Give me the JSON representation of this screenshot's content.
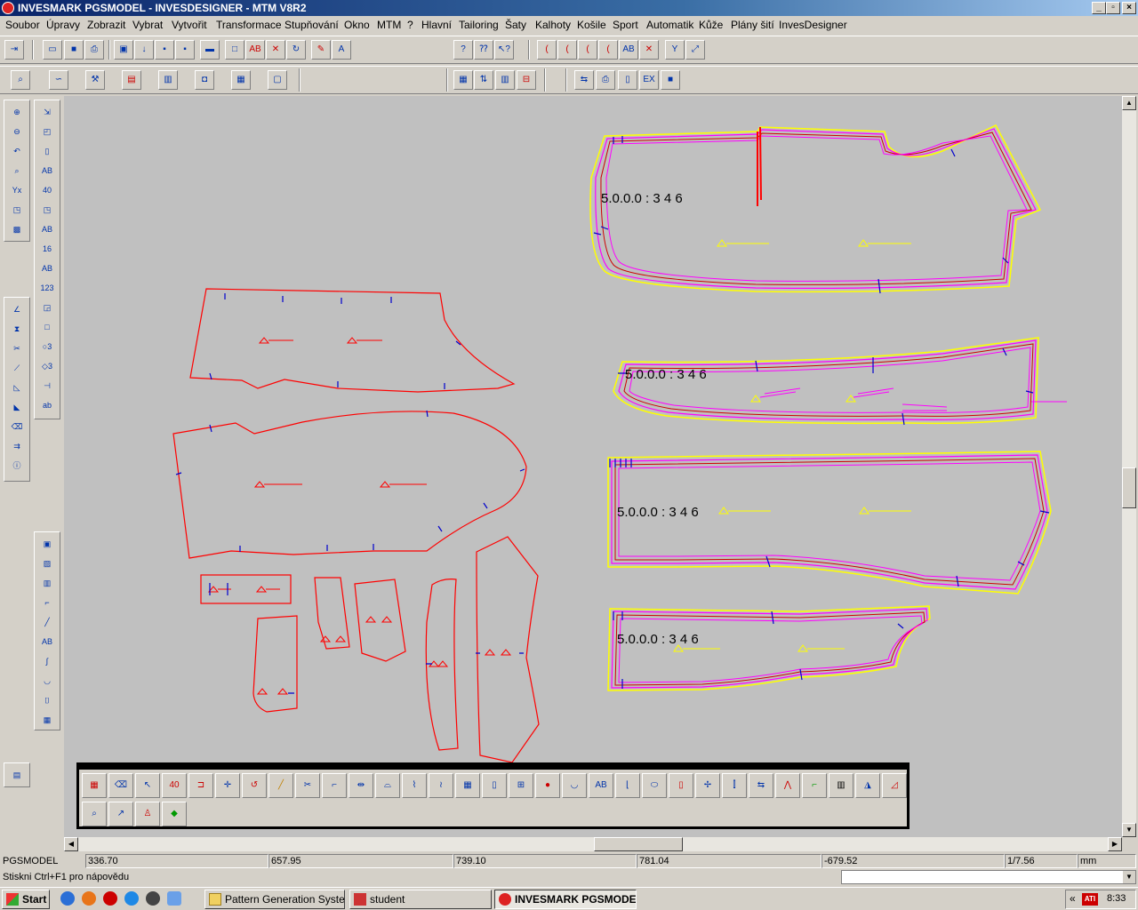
{
  "window": {
    "title": "INVESMARK PGSMODEL - INVESDESIGNER - MTM V8R2",
    "minimize": "_",
    "restore": "▫",
    "close": "×"
  },
  "menu": [
    "Soubor",
    "Úpravy",
    "Zobrazit",
    "Vybrat",
    "Vytvořit",
    "Transformace",
    "Stupňování",
    "Okno",
    "MTM",
    "?",
    "Hlavní",
    "Tailoring",
    "Šaty",
    "Kalhoty",
    "Košile",
    "Sport",
    "Automatik",
    "Kůže",
    "Plány šití",
    "InvesDesigner"
  ],
  "toolbar": {
    "color_swatch": "#e00000",
    "line_style": "———"
  },
  "canvas": {
    "piece_labels": [
      "5.0.0.0 : 3 4 6",
      "5.0.0.0 : 3 4 6",
      "5.0.0.0 : 3 4 6",
      "5.0.0.0 : 3 4 6"
    ],
    "colors": {
      "background": "#c0c0c0",
      "pattern": "#ff0000",
      "seam_outer": "#ffff00",
      "seam_magenta": "#ff00ff",
      "notch": "#0000cc"
    }
  },
  "status": {
    "app": "PGSMODEL",
    "v1": "336.70",
    "v2": "657.95",
    "v3": "739.10",
    "v4": "781.04",
    "v5": "-679.52",
    "scale": "1/7.56",
    "unit": "mm",
    "hint": "Stiskni Ctrl+F1 pro nápovědu"
  },
  "taskbar": {
    "start": "Start",
    "tasks": [
      "Pattern Generation System",
      "student",
      "INVESMARK PGSMODE..."
    ],
    "tray_arrow": "«",
    "tray_logo": "ATI",
    "clock": "8:33"
  }
}
